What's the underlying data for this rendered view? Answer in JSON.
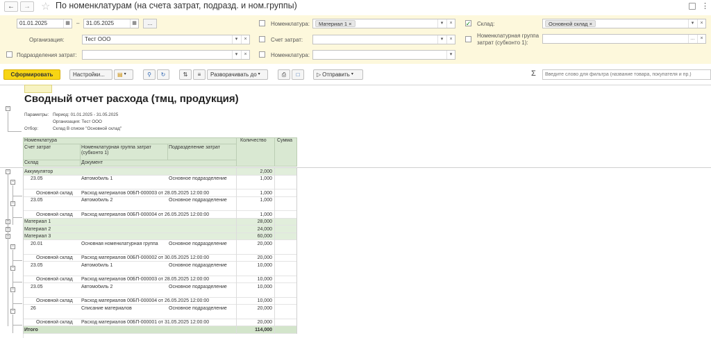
{
  "window": {
    "title": "По номенклатурам (на счета затрат, подразд. и ном.группы)"
  },
  "filters": {
    "date_from": "01.01.2025",
    "date_sep": "–",
    "date_to": "31.05.2025",
    "more_btn": "...",
    "org_label": "Организация:",
    "org_value": "Тест ООО",
    "subdiv_label": "Подразделения затрат:",
    "subdiv_value": "",
    "nom_label": "Номенклатура:",
    "nom_tag": "Материал 1",
    "account_label": "Счет затрат:",
    "account_value": "",
    "nom2_label": "Номенклатура:",
    "nom2_value": "",
    "warehouse_label": "Склад:",
    "warehouse_tag": "Основной склад",
    "nomgroup_label": "Номенклатурная группа затрат (субконто 1):",
    "nomgroup_value": ""
  },
  "toolbar": {
    "generate": "Сформировать",
    "settings": "Настройки...",
    "expand": "Разворачивать до",
    "send": "Отправить",
    "search_placeholder": "Введите слово для фильтра (название товара, покупателя и пр.)",
    "sigma": "Σ"
  },
  "report": {
    "title": "Сводный отчет расхода (тмц, продукция)",
    "params": [
      {
        "label": "Параметры:",
        "value": "Период: 01.01.2025 - 31.05.2025"
      },
      {
        "label": "",
        "value": "Организация: Тест ООО"
      },
      {
        "label": "Отбор:",
        "value": "Склад В списке \"Основной склад\""
      }
    ],
    "header": {
      "nomenclature": "Номенклатура",
      "account": "Счет затрат",
      "nomgroup": "Номенклатурная группа затрат (субконто 1)",
      "subdiv": "Подразделение затрат",
      "warehouse": "Склад",
      "document": "Документ",
      "qty": "Количество",
      "sum": "Сумма"
    },
    "rows": [
      {
        "kind": "group",
        "name": "Аккумулятор",
        "qty": "2,000",
        "tog": "−",
        "expanded": true
      },
      {
        "kind": "sub",
        "account": "23.05",
        "nomgroup": "Автомобиль 1",
        "subdiv": "Основное подразделение",
        "qty": "1,000"
      },
      {
        "kind": "doc",
        "warehouse": "Основной склад",
        "document": "Расход материалов 00БП-000003 от 28.05.2025 12:00:00",
        "qty": "1,000"
      },
      {
        "kind": "sub",
        "account": "23.05",
        "nomgroup": "Автомобиль 2",
        "subdiv": "Основное подразделение",
        "qty": "1,000"
      },
      {
        "kind": "doc",
        "warehouse": "Основной склад",
        "document": "Расход материалов 00БП-000004 от 26.05.2025 12:00:00",
        "qty": "1,000"
      },
      {
        "kind": "group",
        "name": "Материал 1",
        "qty": "28,000",
        "tog": "+",
        "expanded": false
      },
      {
        "kind": "group",
        "name": "Материал 2",
        "qty": "24,000",
        "tog": "+",
        "expanded": false
      },
      {
        "kind": "group",
        "name": "Материал 3",
        "qty": "60,000",
        "tog": "−",
        "expanded": true
      },
      {
        "kind": "sub",
        "account": "20.01",
        "nomgroup": "Основная номенклатурная группа",
        "subdiv": "Основное подразделение",
        "qty": "20,000"
      },
      {
        "kind": "doc",
        "warehouse": "Основной склад",
        "document": "Расход материалов 00БП-000002 от 30.05.2025 12:00:00",
        "qty": "20,000"
      },
      {
        "kind": "sub",
        "account": "23.05",
        "nomgroup": "Автомобиль 1",
        "subdiv": "Основное подразделение",
        "qty": "10,000"
      },
      {
        "kind": "doc",
        "warehouse": "Основной склад",
        "document": "Расход материалов 00БП-000003 от 28.05.2025 12:00:00",
        "qty": "10,000"
      },
      {
        "kind": "sub",
        "account": "23.05",
        "nomgroup": "Автомобиль 2",
        "subdiv": "Основное подразделение",
        "qty": "10,000"
      },
      {
        "kind": "doc",
        "warehouse": "Основной склад",
        "document": "Расход материалов 00БП-000004 от 26.05.2025 12:00:00",
        "qty": "10,000"
      },
      {
        "kind": "sub",
        "account": "26",
        "nomgroup": "Списание материалов",
        "subdiv": "Основное подразделение",
        "qty": "20,000"
      },
      {
        "kind": "doc",
        "warehouse": "Основной склад",
        "document": "Расход материалов 00БП-000001 от 31.05.2025 12:00:00",
        "qty": "20,000"
      },
      {
        "kind": "total",
        "name": "Итого",
        "qty": "114,000"
      }
    ]
  },
  "colors": {
    "panel_bg": "#fdf8dc",
    "header_bg": "#d9e8d2",
    "group_bg": "#e1eedb",
    "accent": "#f7d514"
  }
}
